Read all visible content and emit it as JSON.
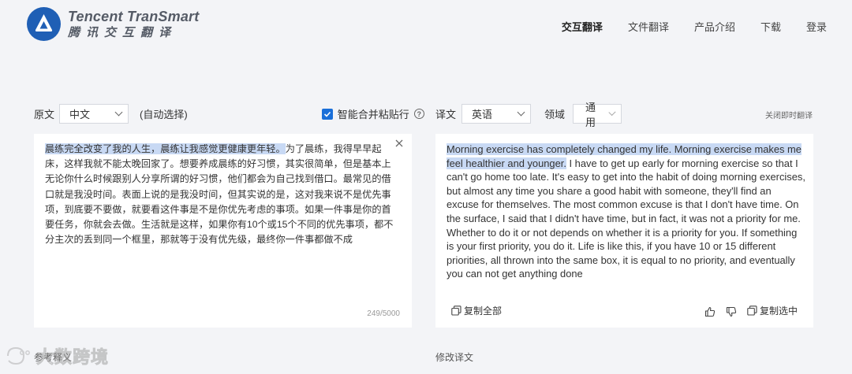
{
  "brand": {
    "name_en": "Tencent TranSmart",
    "name_cn": "腾讯交互翻译",
    "accent": "#1f5fb5"
  },
  "nav": {
    "items": [
      "交互翻译",
      "文件翻译",
      "产品介绍",
      "下载",
      "登录"
    ],
    "active_index": 0
  },
  "source": {
    "label": "原文",
    "language": "中文",
    "auto_detect": "(自动选择)",
    "merge_paste_label": "智能合并粘贴行",
    "merge_paste_checked": true,
    "text_highlighted": "晨练完全改变了我的人生，晨练让我感觉更健康更年轻。",
    "text_rest": "为了晨练，我得早早起床，这样我就不能太晚回家了。想要养成晨练的好习惯，其实很简单，但是基本上无论你什么时候跟别人分享所谓的好习惯，他们都会为自己找到借口。最常见的借口就是我没时间。表面上说的是我没时间，但其实说的是，这对我来说不是优先事项，到底要不要做，就要看这件事是不是你优先考虑的事项。如果一件事是你的首要任务，你就会去做。生活就是这样，如果你有10个或15个不同的优先事项，都不分主次的丢到同一个框里，那就等于没有优先级，最终你一件事都做不成",
    "char_count": "249/5000"
  },
  "target": {
    "label": "译文",
    "language": "英语",
    "domain_label": "领域",
    "domain_value": "通用",
    "close_instant": "关闭即时翻译",
    "text_highlighted": "Morning exercise has completely changed my life. Morning exercise makes me feel healthier and younger.",
    "text_rest": " I have to get up early for morning exercise so that I can't go home too late. It's easy to get into the habit of doing morning exercises, but almost any time you share a good habit with someone, they'll find an excuse for themselves. The most common excuse is that I don't have time. On the surface, I said that I didn't have time, but in fact, it was not a priority for me. Whether to do it or not depends on whether it is a priority for you. If something is your first priority, you do it. Life is like this, if you have 10 or 15 different priorities, all thrown into the same box, it is equal to no priority, and eventually you can not get anything done",
    "copy_all": "复制全部",
    "copy_selected": "复制选中"
  },
  "bottom": {
    "left_label": "参考释义",
    "right_label": "修改译文"
  },
  "watermark": "大数跨境"
}
